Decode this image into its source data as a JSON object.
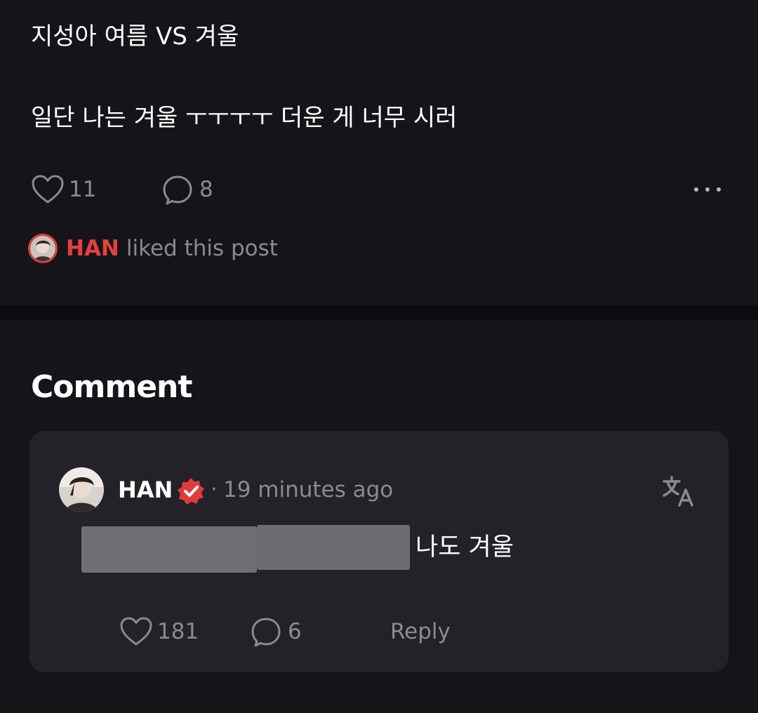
{
  "post": {
    "title": "지성아 여름 VS 겨울",
    "body": "일단 나는 겨울 ㅜㅜㅜㅜ 더운 게 너무 시러",
    "like_count": "11",
    "comment_count": "8",
    "liked_by_name": "HAN",
    "liked_by_text": "liked this post"
  },
  "comments": {
    "heading": "Comment",
    "items": [
      {
        "author": "HAN",
        "separator": "·",
        "time": "19 minutes ago",
        "text": "나도 겨울",
        "like_count": "181",
        "reply_count": "6",
        "reply_label": "Reply"
      }
    ]
  },
  "icons": {
    "like": "heart-outline-icon",
    "comment": "speech-bubble-icon",
    "more": "more-horizontal-icon",
    "verified": "verified-badge-icon",
    "translate": "translate-icon"
  },
  "colors": {
    "background": "#151519",
    "card": "#222228",
    "accent_red": "#e5403f",
    "muted_text": "#8a8a90"
  }
}
